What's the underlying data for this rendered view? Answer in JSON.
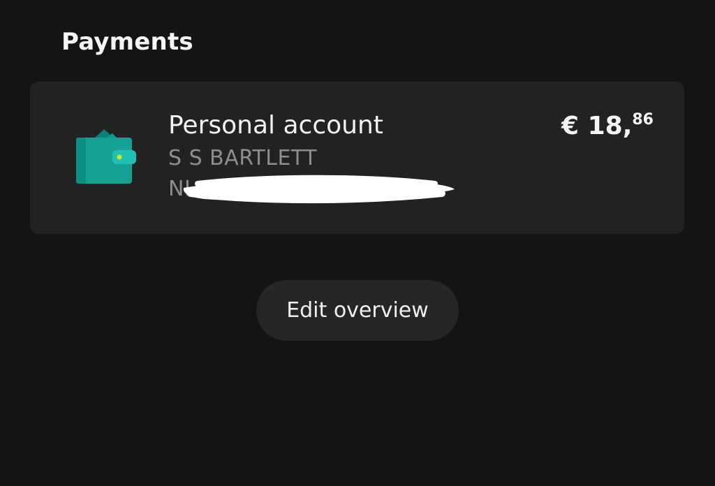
{
  "section": {
    "title": "Payments"
  },
  "account": {
    "icon": "wallet-icon",
    "name": "Personal account",
    "holder": "S S BARTLETT",
    "iban_visible_prefix": "NL",
    "balance_currency": "€",
    "balance_whole": "18",
    "balance_cents": "86",
    "icon_color": "#1aa39a",
    "icon_accent": "#d9e021"
  },
  "actions": {
    "edit_overview_label": "Edit overview"
  },
  "colors": {
    "background": "#141414",
    "card": "#222222",
    "button": "#262626"
  }
}
